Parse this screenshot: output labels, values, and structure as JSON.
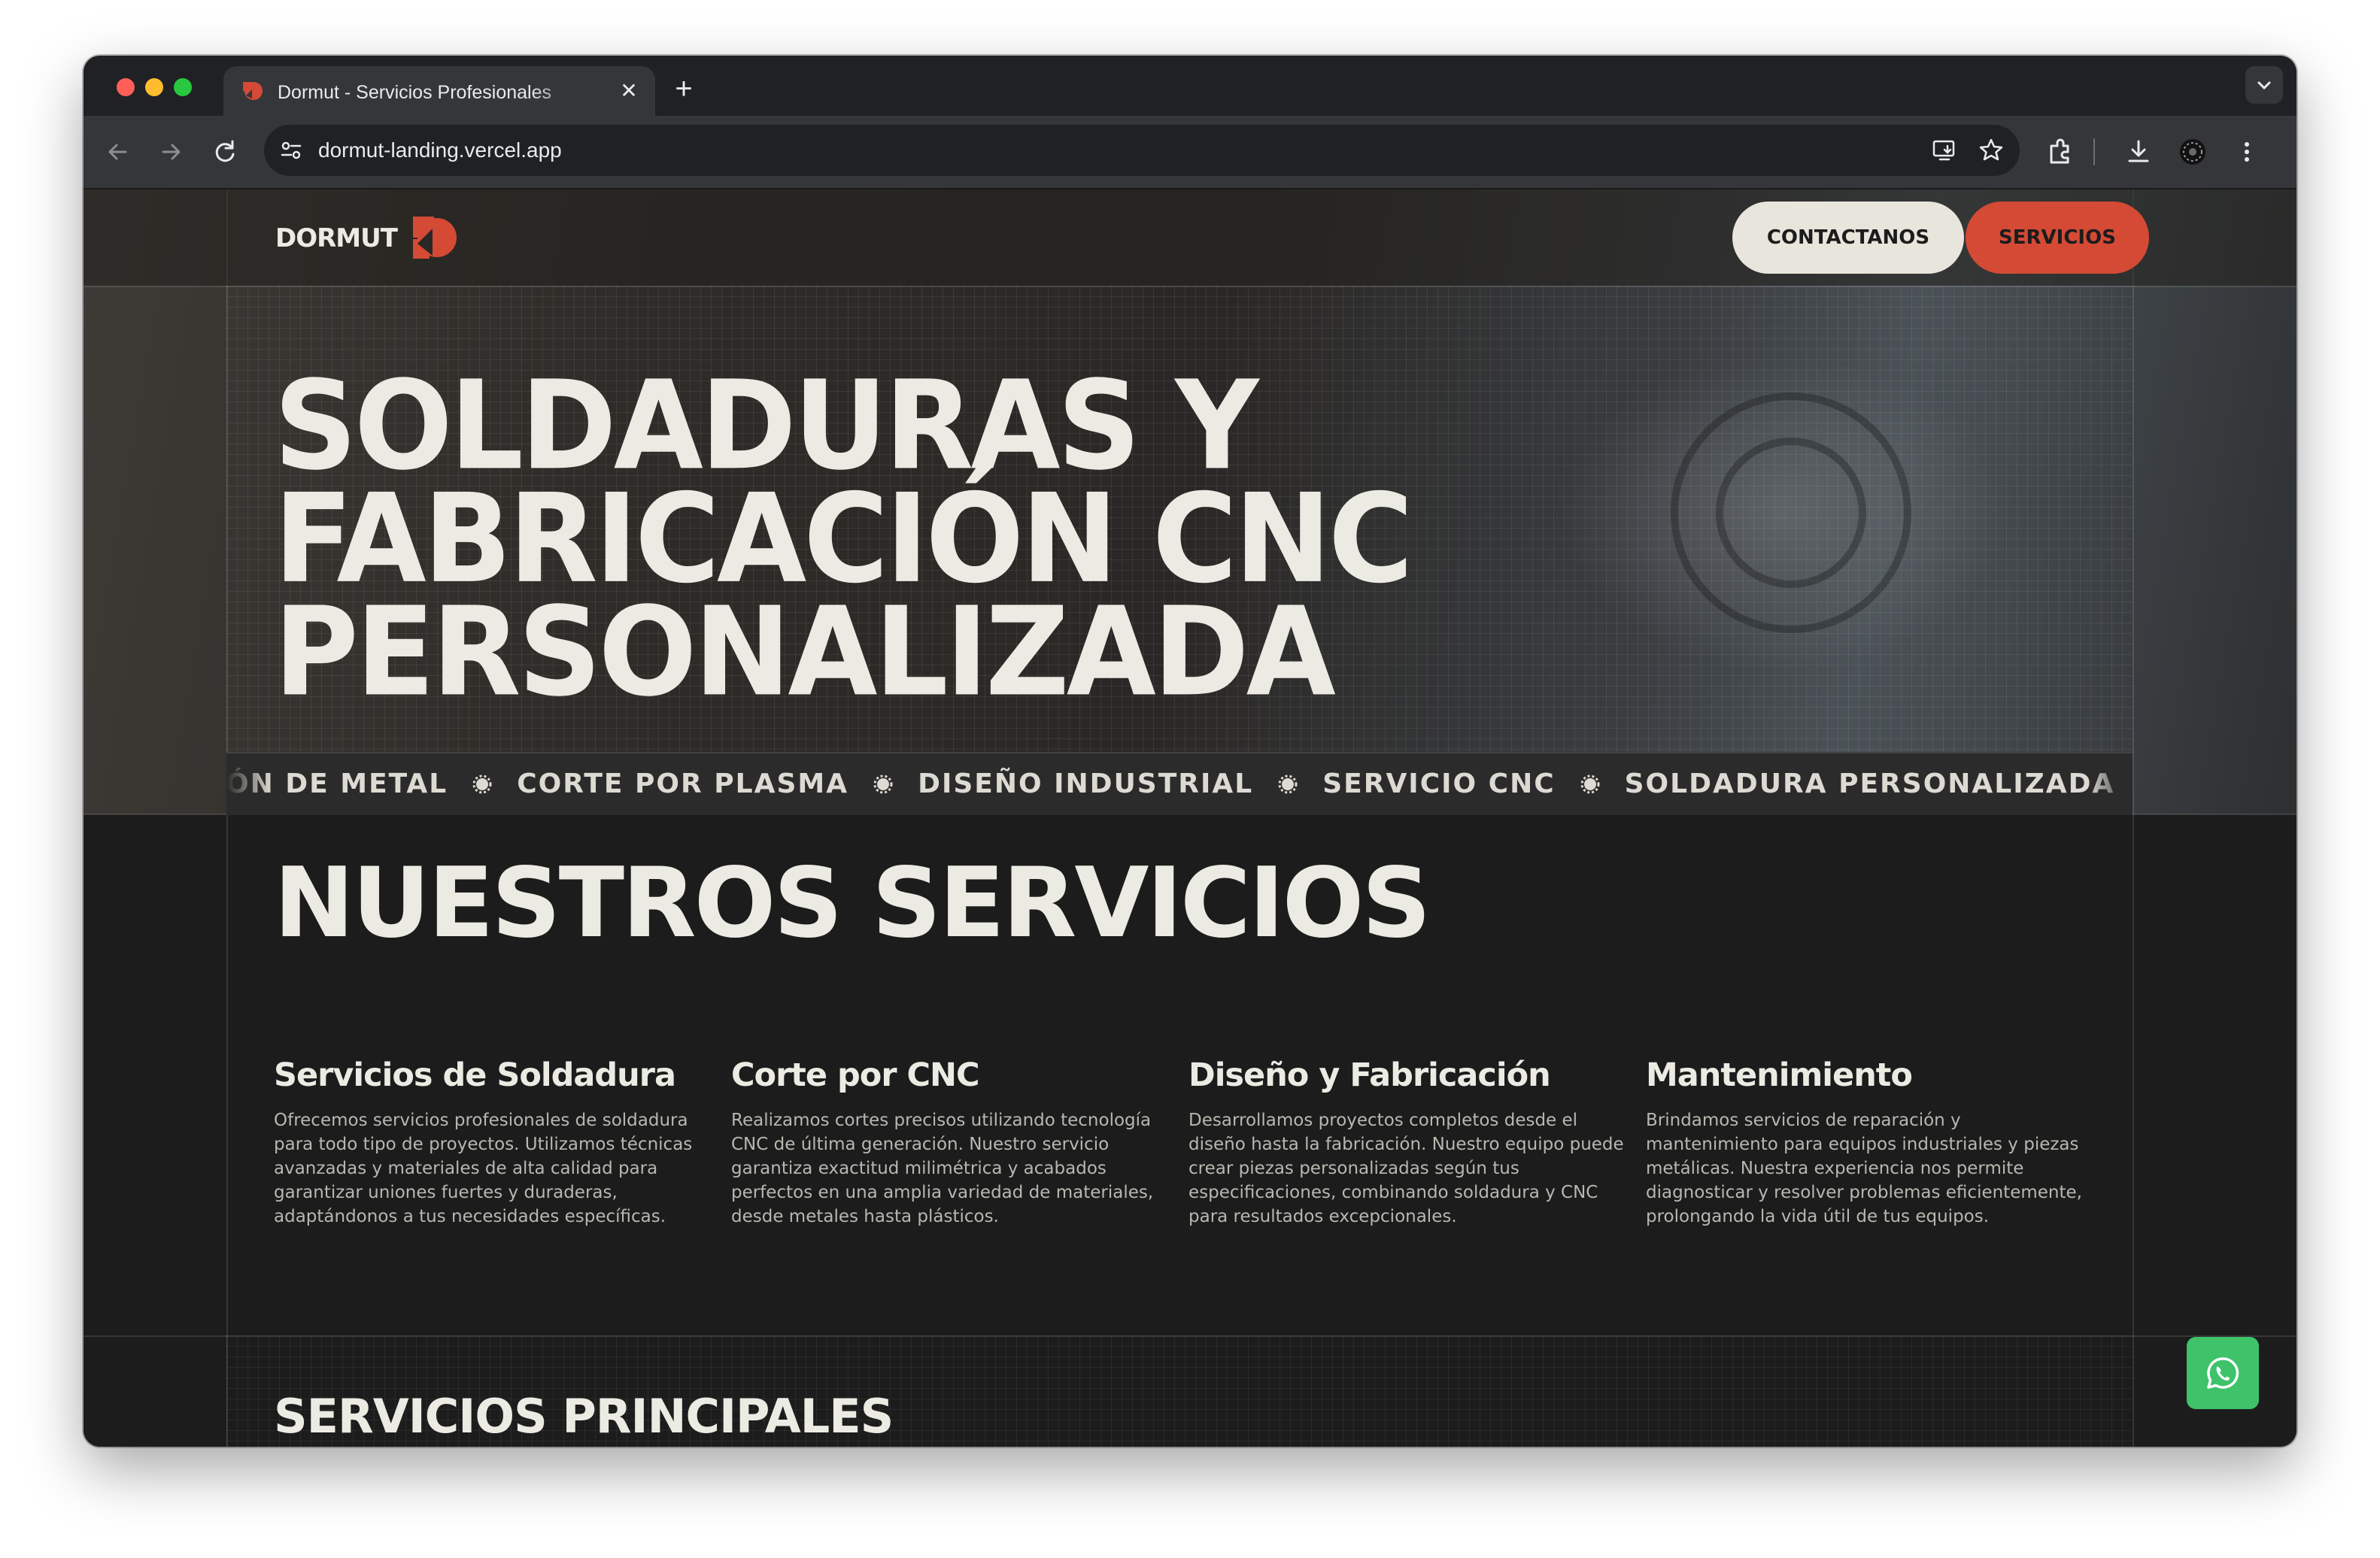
{
  "browser": {
    "tab_title": "Dormut - Servicios Profesionales",
    "tab_close": "✕",
    "new_tab": "+",
    "url": "dormut-landing.vercel.app"
  },
  "header": {
    "logo_text": "DORMUT",
    "contact_label": "CONTACTANOS",
    "services_label": "SERVICIOS",
    "accent_color": "#d44a35"
  },
  "hero": {
    "title_lines": [
      "SOLDADURAS Y",
      "FABRICACIÓN CNC",
      "PERSONALIZADA"
    ]
  },
  "marquee": {
    "items": [
      "FABRICACIÓN DE METAL",
      "CORTE POR PLASMA",
      "DISEÑO INDUSTRIAL",
      "SERVICIO CNC",
      "SOLDADURA PERSONALIZADA"
    ]
  },
  "services": {
    "title": "NUESTROS SERVICIOS",
    "cards": [
      {
        "title": "Servicios de Soldadura",
        "text": "Ofrecemos servicios profesionales de soldadura para todo tipo de proyectos. Utilizamos técnicas avanzadas y materiales de alta calidad para garantizar uniones fuertes y duraderas, adaptándonos a tus necesidades específicas."
      },
      {
        "title": "Corte por CNC",
        "text": "Realizamos cortes precisos utilizando tecnología CNC de última generación. Nuestro servicio garantiza exactitud milimétrica y acabados perfectos en una amplia variedad de materiales, desde metales hasta plásticos."
      },
      {
        "title": "Diseño y Fabricación",
        "text": "Desarrollamos proyectos completos desde el diseño hasta la fabricación. Nuestro equipo puede crear piezas personalizadas según tus especificaciones, combinando soldadura y CNC para resultados excepcionales."
      },
      {
        "title": "Mantenimiento",
        "text": "Brindamos servicios de reparación y mantenimiento para equipos industriales y piezas metálicas. Nuestra experiencia nos permite diagnosticar y resolver problemas eficientemente, prolongando la vida útil de tus equipos."
      }
    ]
  },
  "principal": {
    "title": "SERVICIOS PRINCIPALES"
  },
  "icons": {
    "whatsapp": "whatsapp-icon",
    "whatsapp_color": "#3ec26a"
  }
}
